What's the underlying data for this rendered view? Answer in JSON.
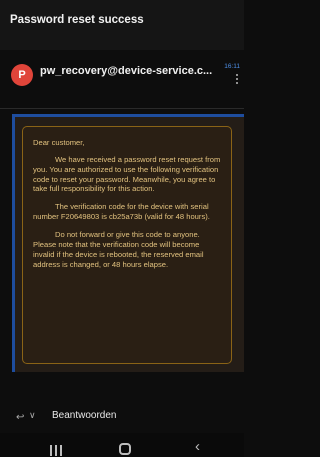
{
  "header": {
    "subject": "Password reset success"
  },
  "message": {
    "avatar_letter": "P",
    "sender": "pw_recovery@device-service.c...",
    "time": "16:11"
  },
  "notice": {
    "greeting": "Dear customer,",
    "paragraphs": [
      "We have received a password reset request from you. You are authorized to use the following verification code to reset your password. Meanwhile, you agree to take full responsibility for this action.",
      "The verification code for the device with serial number F20649803 is cb25a73b (valid for 48 hours).",
      "Do not forward or give this code to anyone. Please note that the verification code will become invalid if the device is rebooted, the reserved email address is changed, or 48 hours elapse."
    ]
  },
  "reply": {
    "label": "Beantwoorden"
  },
  "colors": {
    "avatar": "#e0453a",
    "time": "#4e8fe6",
    "notice_text": "#e2c27f",
    "notice_border": "#8a6316",
    "frame_accent": "#1e4d9e"
  },
  "icons": {
    "reply": "reply-icon",
    "chevron": "chevron-down-icon",
    "more": "more-vertical-icon",
    "nav_recent": "recent-apps-icon",
    "nav_home": "home-icon",
    "nav_back": "back-icon"
  }
}
